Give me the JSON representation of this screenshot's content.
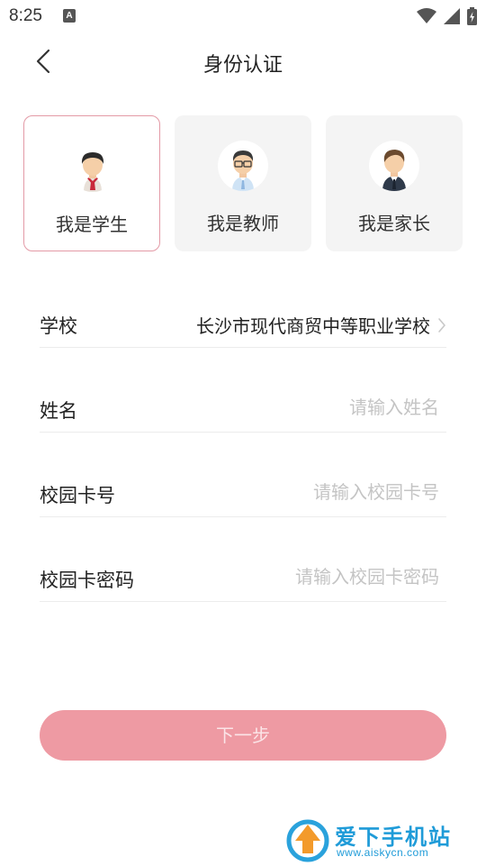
{
  "status_bar": {
    "time": "8:25",
    "notify_letter": "A"
  },
  "header": {
    "title": "身份认证"
  },
  "roles": [
    {
      "label": "我是学生",
      "selected": true
    },
    {
      "label": "我是教师",
      "selected": false
    },
    {
      "label": "我是家长",
      "selected": false
    }
  ],
  "form": {
    "school": {
      "label": "学校",
      "value": "长沙市现代商贸中等职业学校"
    },
    "name": {
      "label": "姓名",
      "placeholder": "请输入姓名"
    },
    "card_no": {
      "label": "校园卡号",
      "placeholder": "请输入校园卡号"
    },
    "card_pwd": {
      "label": "校园卡密码",
      "placeholder": "请输入校园卡密码"
    }
  },
  "next_button": {
    "label": "下一步"
  },
  "watermark": {
    "text": "爱下手机站",
    "url": "www.aiskycn.com"
  },
  "colors": {
    "accent": "#ee9aa3",
    "selected_border": "#e39aa6",
    "placeholder": "#c4c4c4"
  }
}
